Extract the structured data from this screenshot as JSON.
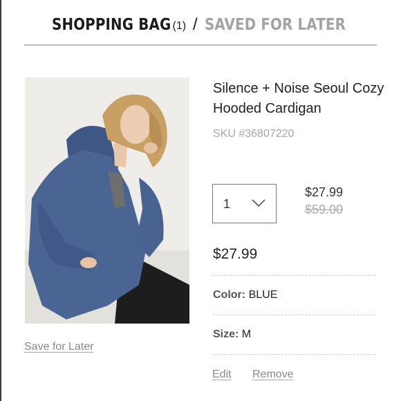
{
  "header": {
    "bag_label": "SHOPPING BAG",
    "bag_count": "(1)",
    "separator": "/",
    "saved_label": "SAVED FOR LATER"
  },
  "product": {
    "name": "Silence + Noise Seoul Cozy Hooded Cardigan",
    "sku": "SKU #36807220",
    "image_alt": "model wearing blue hooded cardigan",
    "quantity": "1",
    "price": "$27.99",
    "original_price": "$59.00",
    "line_total": "$27.99",
    "color_label": "Color:",
    "color_value": "BLUE",
    "size_label": "Size:",
    "size_value": "M"
  },
  "actions": {
    "save_for_later": "Save for Later",
    "edit": "Edit",
    "remove": "Remove"
  },
  "icons": {
    "quantity_dropdown": "chevron-down-icon"
  },
  "colors": {
    "text": "#222222",
    "muted": "#a3a3a3",
    "cardigan": "#4a6594"
  }
}
